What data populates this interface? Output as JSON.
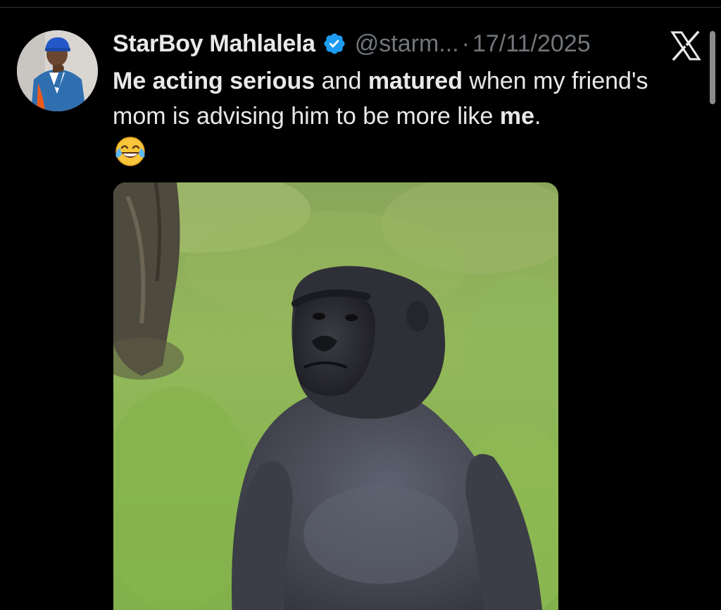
{
  "tweet": {
    "author": {
      "display_name": "StarBoy Mahlalela",
      "handle": "@starm...",
      "verified": true,
      "verified_icon": "verified-badge-icon"
    },
    "separator": "·",
    "timestamp": "17/11/2025",
    "platform_icon": "x-logo-icon",
    "text_segments": {
      "s1": "Me acting serious",
      "s2": " and ",
      "s3": "matured",
      "s4": " when my friend's mom is advising him to be more like ",
      "s5": "me",
      "s6": "."
    },
    "emoji": "face-with-tears-of-joy",
    "media": {
      "type": "photo",
      "subject": "gorilla"
    }
  },
  "colors": {
    "background": "#000000",
    "text": "#e7e9ea",
    "secondary_text": "#71767b",
    "verified_blue": "#1d9bf0"
  }
}
